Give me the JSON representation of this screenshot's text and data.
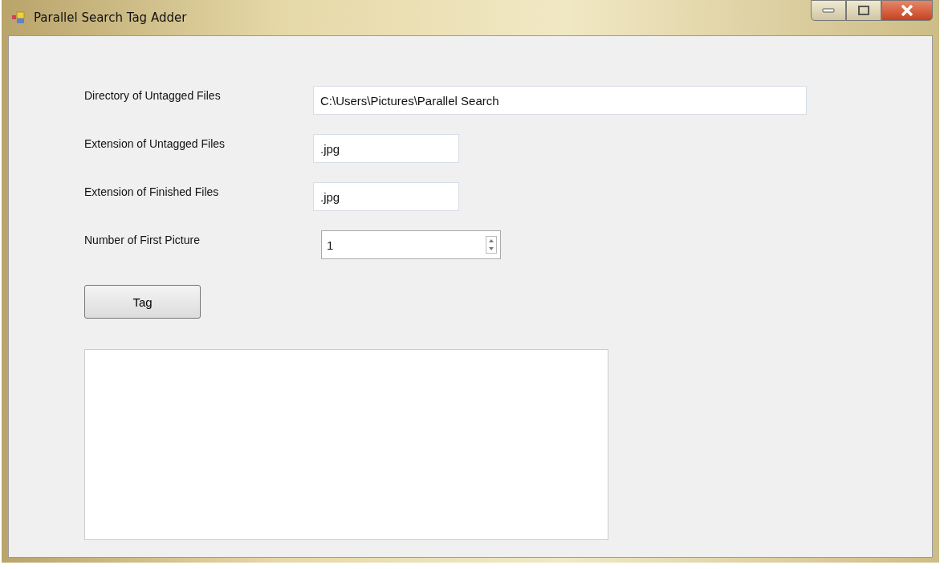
{
  "window": {
    "title": "Parallel Search Tag Adder"
  },
  "fields": [
    {
      "label": "Directory of Untagged Files",
      "value": "C:\\Users\\Pictures\\Parallel Search",
      "kind": "wide"
    },
    {
      "label": "Extension of Untagged Files",
      "value": ".jpg",
      "kind": "short"
    },
    {
      "label": "Extension of Finished Files",
      "value": ".jpg",
      "kind": "short"
    },
    {
      "label": "Number of First Picture",
      "value": "1",
      "kind": "spinner"
    }
  ],
  "button": {
    "label": "Tag"
  }
}
